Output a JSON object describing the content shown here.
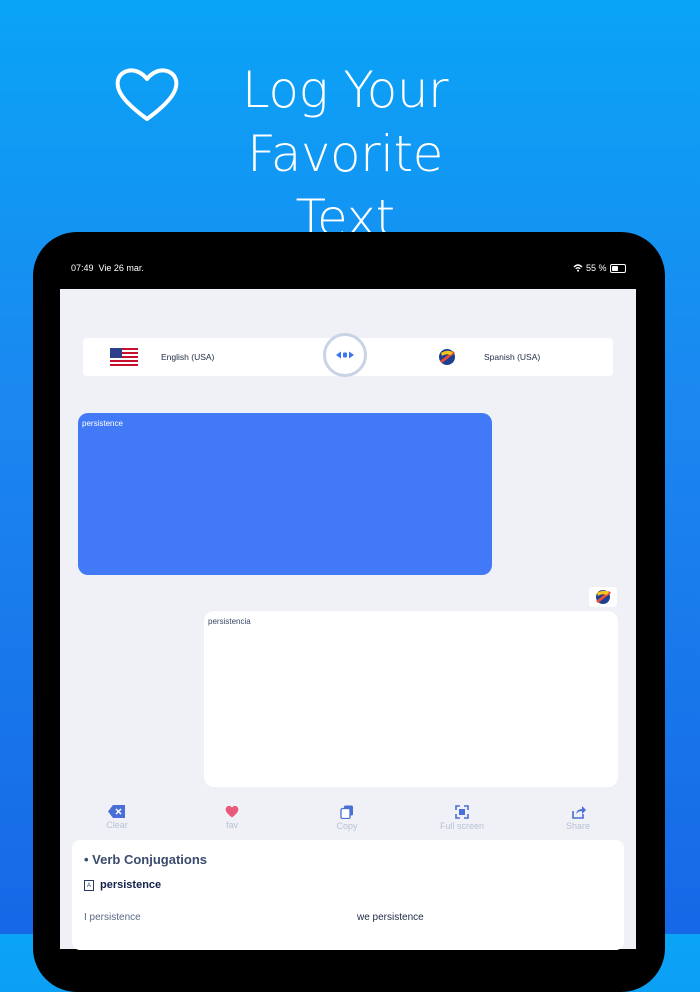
{
  "promo": {
    "headline": "Log Your Favorite Text"
  },
  "status_bar": {
    "time": "07:49",
    "date": "Vie 26 mar.",
    "battery": "55 %"
  },
  "languages": {
    "source": {
      "label": "English (USA)",
      "flag": "us-flag-icon"
    },
    "target": {
      "label": "Spanish (USA)",
      "flag": "spain-flag-icon"
    }
  },
  "source_text": "persistence",
  "translated_text": "persistencia",
  "toolbar": [
    {
      "label": "Clear",
      "icon": "clear-icon"
    },
    {
      "label": "fav",
      "icon": "heart-icon"
    },
    {
      "label": "Copy",
      "icon": "copy-icon"
    },
    {
      "label": "Full screen",
      "icon": "fullscreen-icon"
    },
    {
      "label": "Share",
      "icon": "share-icon"
    }
  ],
  "verb_conjugations": {
    "title": "• Verb Conjugations",
    "word": "persistence",
    "forms": [
      "I persistence",
      "we persistence"
    ]
  },
  "colors": {
    "accent": "#4279f7",
    "fav": "#e85a7a"
  }
}
